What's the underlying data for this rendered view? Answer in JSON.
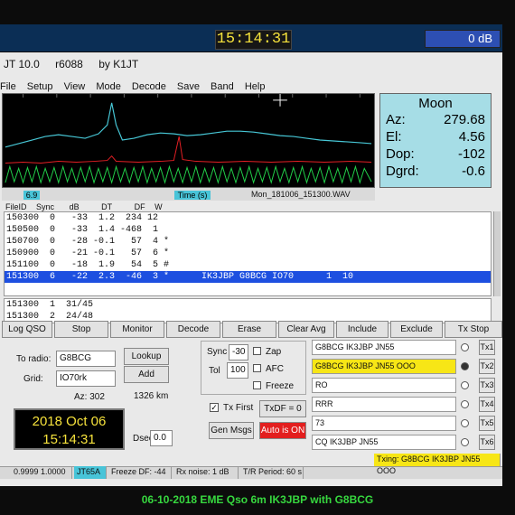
{
  "top": {
    "clock": "15:14:31",
    "db": "0 dB"
  },
  "app": {
    "title": "JT 10.0",
    "revision": "r6088",
    "author": "by K1JT"
  },
  "menu": [
    "File",
    "Setup",
    "View",
    "Mode",
    "Decode",
    "Save",
    "Band",
    "Help"
  ],
  "spectrum": {
    "freq_label": "6.9",
    "time_label": "Time (s)",
    "wav_file": "Mon_181006_151300.WAV",
    "colors": {
      "cyan": "#47c7d6",
      "red": "#e41f24",
      "green": "#22d14a"
    }
  },
  "moon": {
    "title": "Moon",
    "az_label": "Az:",
    "az": "279.68",
    "el_label": "El:",
    "el": "4.56",
    "dop_label": "Dop:",
    "dop": "-102",
    "dgrd_label": "Dgrd:",
    "dgrd": "-0.6"
  },
  "table": {
    "columns": [
      "FileID",
      "Sync",
      "dB",
      "DT",
      "DF",
      "W"
    ],
    "rows": [
      "150300  0   -33  1.2  234 12",
      "150500  0   -33  1.4 -468  1",
      "150700  0   -28 -0.1   57  4 *",
      "150900  0   -21 -0.1   57  6 *",
      "151100  0   -18  1.9   54  5 #",
      "151300  6   -22  2.3  -46  3 *      IK3JBP G8BCG IO70      1  10"
    ],
    "averages": [
      "151300  1  31/45",
      "151300  2  24/48"
    ]
  },
  "buttons": [
    "Log QSO",
    "Stop",
    "Monitor",
    "Decode",
    "Erase",
    "Clear Avg",
    "Include",
    "Exclude",
    "Tx Stop"
  ],
  "station": {
    "to_radio_label": "To radio:",
    "to_radio": "G8BCG",
    "grid_label": "Grid:",
    "grid": "IO70rk",
    "lookup": "Lookup",
    "add": "Add",
    "az_text": "Az: 302",
    "dist_text": "1326 km",
    "date": "2018 Oct 06",
    "time": "15:14:31",
    "dsec_label": "Dsec",
    "dsec": "0.0"
  },
  "controls": {
    "sync_label": "Sync",
    "sync": "-30",
    "tol_label": "Tol",
    "tol": "100",
    "zap": "Zap",
    "afc": "AFC",
    "freeze": "Freeze",
    "tx_first": "Tx First",
    "txdf": "TxDF = 0",
    "gen_msgs": "Gen Msgs",
    "auto": "Auto is ON"
  },
  "tx_messages": [
    {
      "text": "G8BCG IK3JBP JN55",
      "btn": "Tx1"
    },
    {
      "text": "G8BCG IK3JBP JN55 OOO",
      "btn": "Tx2"
    },
    {
      "text": "RO",
      "btn": "Tx3"
    },
    {
      "text": "RRR",
      "btn": "Tx4"
    },
    {
      "text": "73",
      "btn": "Tx5"
    },
    {
      "text": "CQ IK3JBP JN55",
      "btn": "Tx6"
    }
  ],
  "status": {
    "levels": "0.9999  1.0000",
    "mode": "JT65A",
    "freeze": "Freeze DF: -44",
    "rxnoise": "Rx noise:  1 dB",
    "tr": "T/R Period: 60 s",
    "txing": "Txing:  G8BCG IK3JBP JN55 OOO"
  },
  "caption": "06-10-2018  EME Qso  6m  IK3JBP with G8BCG"
}
